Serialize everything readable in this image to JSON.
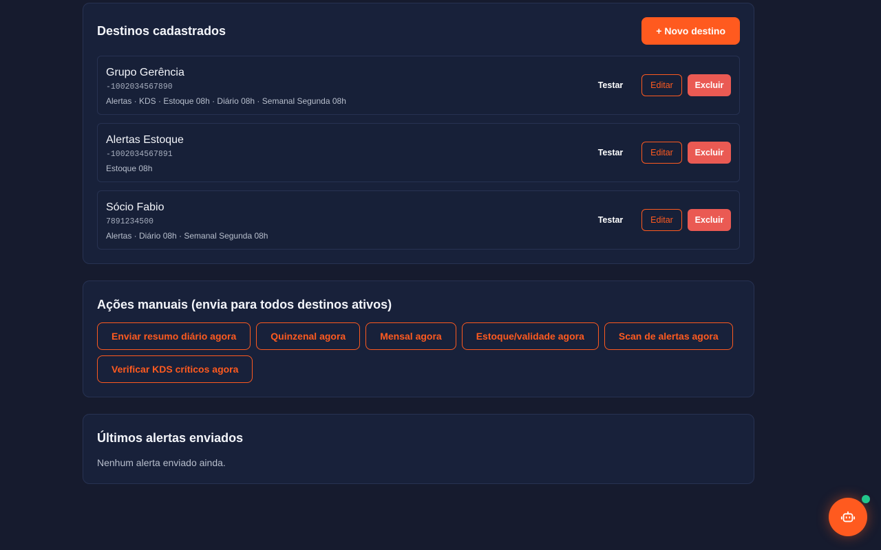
{
  "destinos": {
    "title": "Destinos cadastrados",
    "new_button": "+ Novo destino",
    "actions": {
      "test": "Testar",
      "edit": "Editar",
      "delete": "Excluir"
    },
    "items": [
      {
        "name": "Grupo Gerência",
        "id": "-1002034567890",
        "tags": "Alertas · KDS · Estoque 08h · Diário 08h · Semanal Segunda 08h"
      },
      {
        "name": "Alertas Estoque",
        "id": "-1002034567891",
        "tags": "Estoque 08h"
      },
      {
        "name": "Sócio Fabio",
        "id": "7891234500",
        "tags": "Alertas · Diário 08h · Semanal Segunda 08h"
      }
    ]
  },
  "acoes": {
    "title": "Ações manuais (envia para todos destinos ativos)",
    "buttons": [
      "Enviar resumo diário agora",
      "Quinzenal agora",
      "Mensal agora",
      "Estoque/validade agora",
      "Scan de alertas agora",
      "Verificar KDS críticos agora"
    ]
  },
  "ultimos": {
    "title": "Últimos alertas enviados",
    "empty": "Nenhum alerta enviado ainda."
  },
  "assistant": {
    "icon": "robot-icon",
    "status": "online"
  },
  "colors": {
    "accent": "#ff5a1f",
    "danger": "#ea5a53",
    "online": "#22c58b",
    "background": "#161b2e",
    "card": "#18213a"
  }
}
